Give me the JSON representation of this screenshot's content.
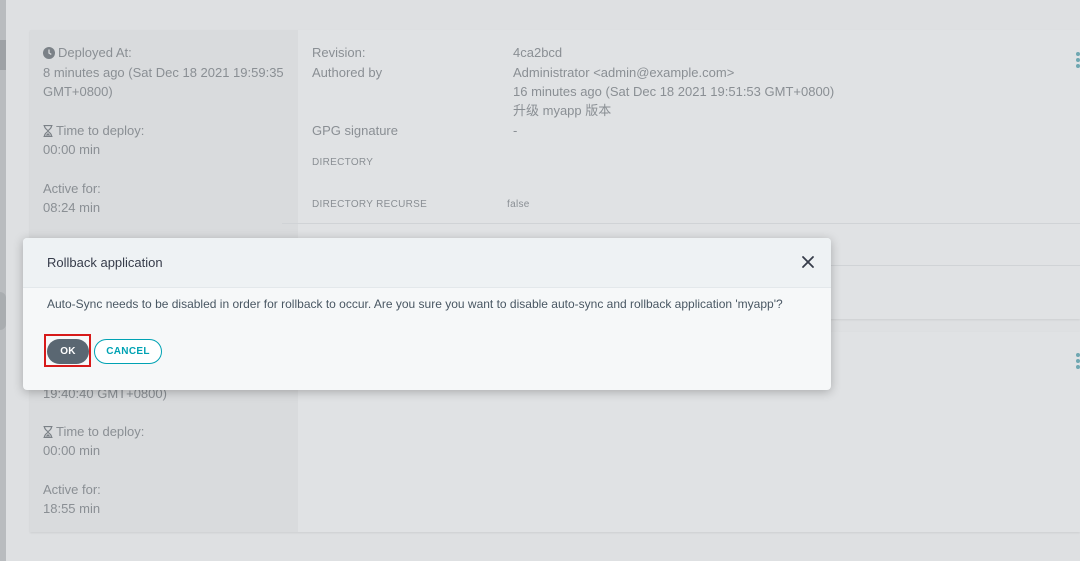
{
  "history": [
    {
      "deployed_at_label": "Deployed At:",
      "deployed_at_line1": "8 minutes ago (Sat Dec 18 2021 19:59:35",
      "deployed_at_line2": "GMT+0800)",
      "time_to_deploy_label": "Time to deploy:",
      "time_to_deploy_value": "00:00 min",
      "active_for_label": "Active for:",
      "active_for_value": "08:24 min",
      "revision_label": "Revision:",
      "revision_value": "4ca2bcd",
      "authored_by_label": "Authored by",
      "author": "Administrator <admin@example.com>",
      "authored_time": "16 minutes ago (Sat Dec 18 2021 19:51:53 GMT+0800)",
      "commit_message": "升级 myapp 版本",
      "gpg_label": "GPG signature",
      "gpg_value": "-",
      "directory_label": "DIRECTORY",
      "directory_recurse_label": "DIRECTORY RECURSE",
      "directory_recurse_value": "false"
    },
    {
      "deployed_at_partial": "19:40:40 GMT+0800)",
      "time_to_deploy_label": "Time to deploy:",
      "time_to_deploy_value": "00:00 min",
      "active_for_label": "Active for:",
      "active_for_value": "18:55 min"
    }
  ],
  "modal": {
    "title": "Rollback application",
    "message": "Auto-Sync needs to be disabled in order for rollback to occur. Are you sure you want to disable auto-sync and rollback application 'myapp'?",
    "ok_label": "OK",
    "cancel_label": "CANCEL"
  },
  "icons": {
    "clock": "clock-icon",
    "hourglass": "hourglass-icon",
    "close": "close-icon",
    "menu": "more-vertical-icon"
  },
  "colors": {
    "accent": "#00a2b3",
    "ok_button": "#5a6772",
    "highlight": "#d71a1a"
  }
}
